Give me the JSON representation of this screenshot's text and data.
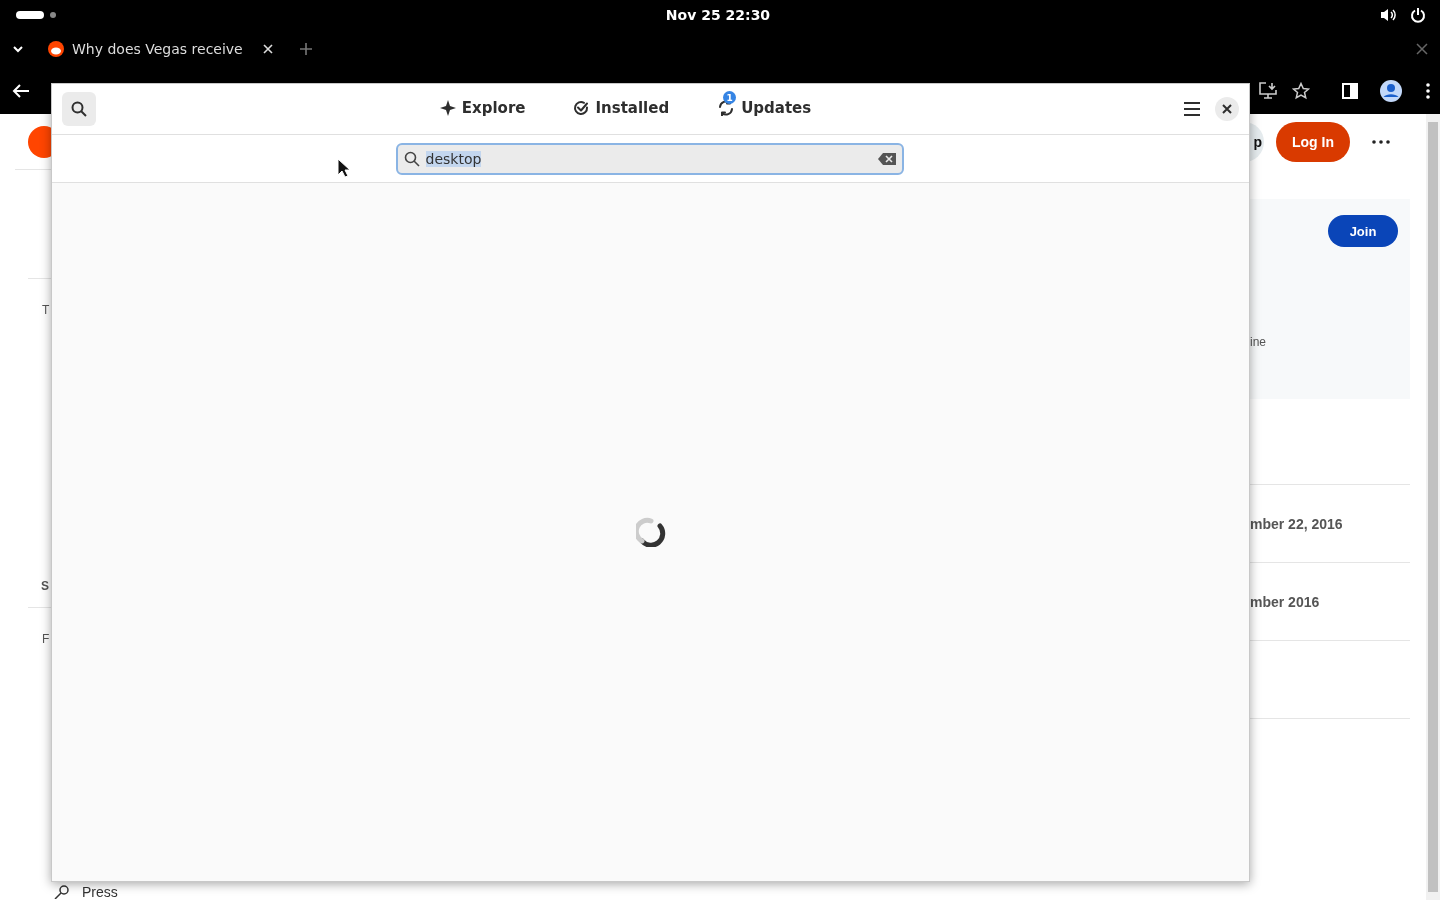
{
  "top_bar": {
    "clock": "Nov 25  22:30"
  },
  "browser": {
    "tab": {
      "title": "Why does Vegas receive"
    },
    "page": {
      "header_button": "p",
      "login_button": "Log In",
      "join_button": "Join",
      "left_fragments": [
        "T",
        "S",
        "F"
      ],
      "side_note": "ine",
      "side_rows": [
        "mber 22, 2016",
        "mber 2016"
      ],
      "footer_link": "Press"
    }
  },
  "software_window": {
    "tabs": [
      {
        "label": "Explore",
        "kind": "explore",
        "selected": false
      },
      {
        "label": "Installed",
        "kind": "installed",
        "selected": false
      },
      {
        "label": "Updates",
        "kind": "updates",
        "selected": false,
        "badge": "1"
      }
    ],
    "search": {
      "value": "desktop",
      "text_selected": true
    },
    "loading": true
  }
}
